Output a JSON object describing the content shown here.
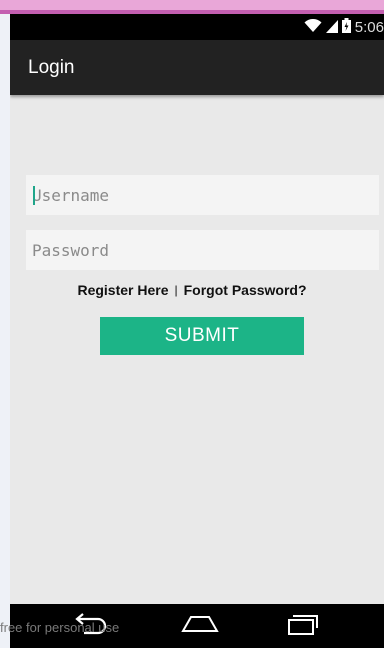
{
  "status_bar": {
    "time": "5:06",
    "icons": [
      "wifi-icon",
      "signal-icon",
      "battery-icon"
    ]
  },
  "action_bar": {
    "title": "Login"
  },
  "form": {
    "username_placeholder": "Username",
    "username_value": "",
    "password_placeholder": "Password",
    "password_value": "",
    "register_link": "Register Here",
    "separator": "|",
    "forgot_link": "Forgot Password?",
    "submit_label": "SUBMIT"
  },
  "nav_bar": {
    "icons": [
      "back-icon",
      "home-icon",
      "recent-apps-icon"
    ]
  },
  "watermark": "free for personal use",
  "colors": {
    "accent": "#1cb487",
    "action_bar": "#222222",
    "status_bar": "#000000",
    "background": "#e9e9e9"
  }
}
